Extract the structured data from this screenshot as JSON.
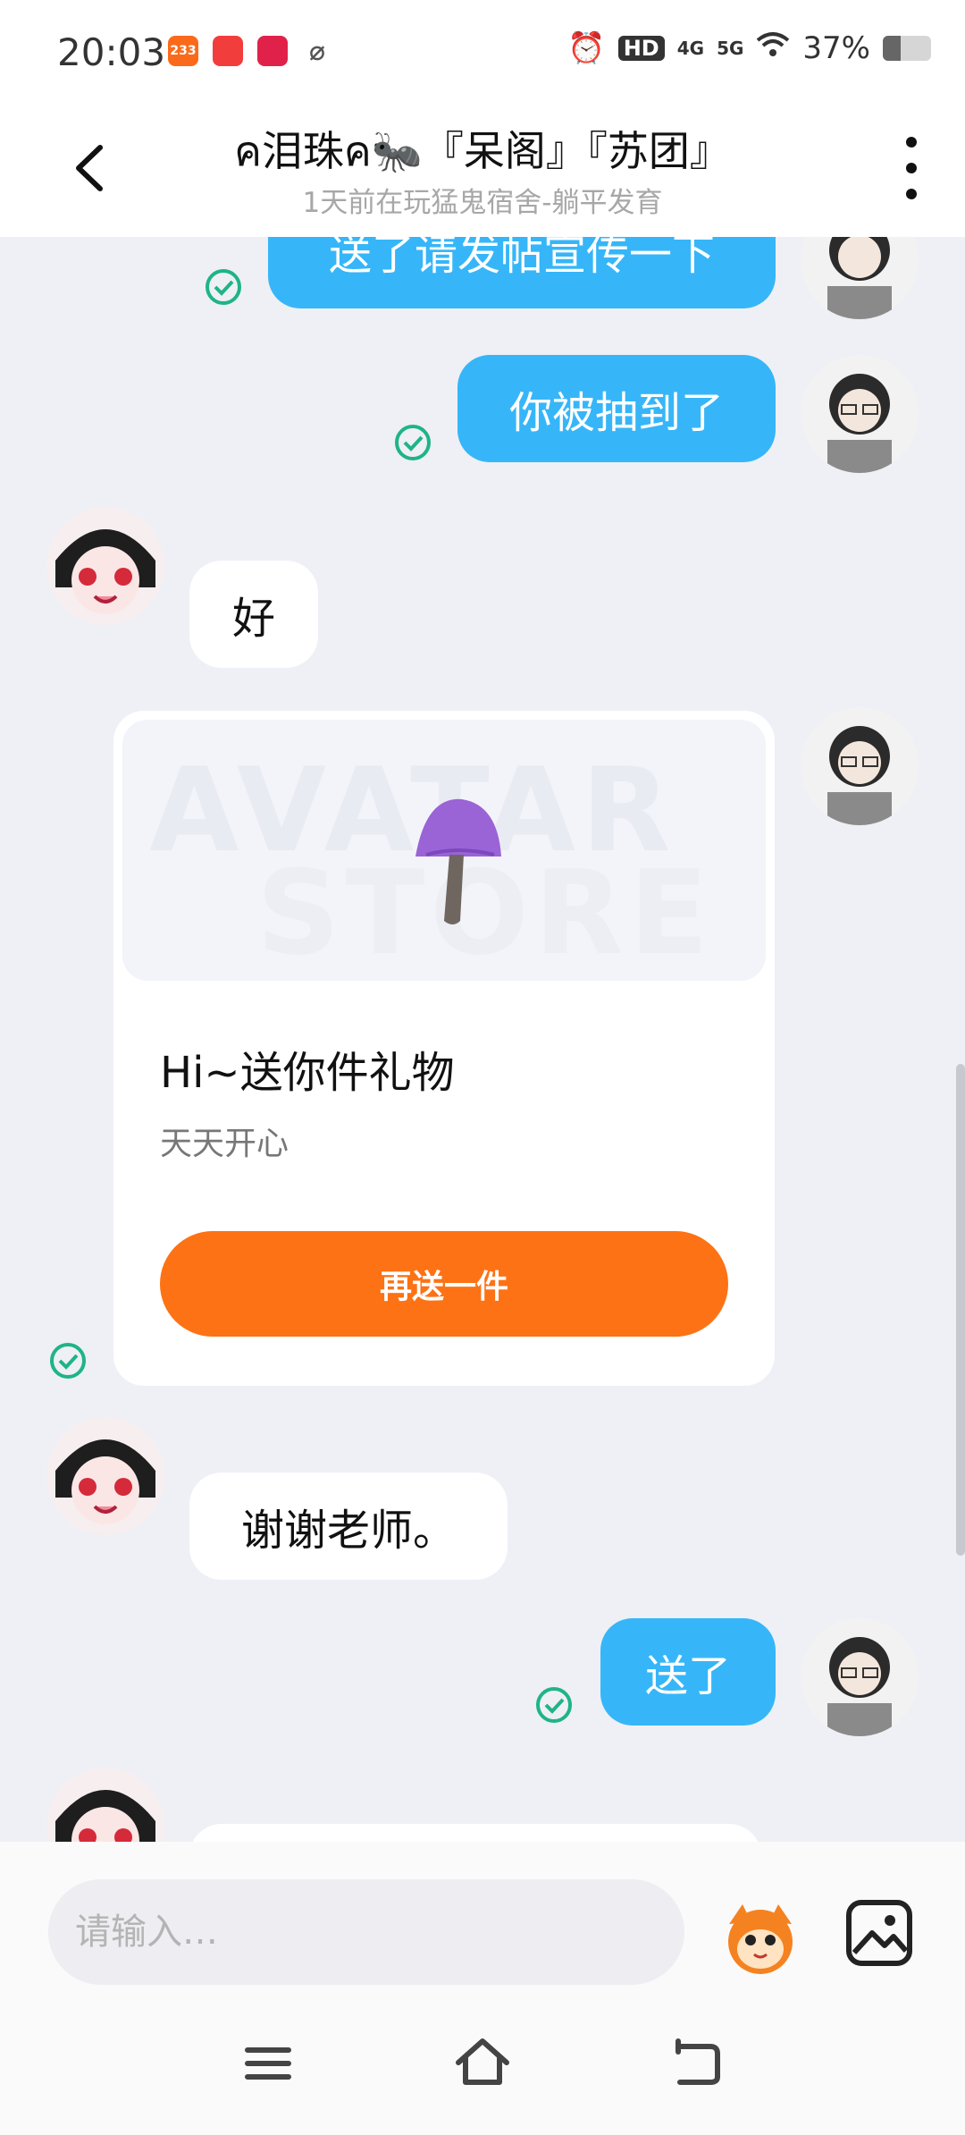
{
  "status_bar": {
    "time": "20:03",
    "app_icons": [
      {
        "name": "233-icon",
        "label": "233",
        "color": "#fb6a1a"
      },
      {
        "name": "music-app-icon",
        "label": "",
        "color": "#f23d3d"
      },
      {
        "name": "shopping-app-icon",
        "label": "",
        "color": "#e0224b"
      },
      {
        "name": "link-app-icon",
        "label": "",
        "color": "#555555"
      }
    ],
    "network_hd": "HD",
    "signal_4g": "4G",
    "signal_5g": "5G",
    "battery": "37%",
    "battery_level": 0.37
  },
  "header": {
    "title": "ค泪珠ค🐜『呆阁』『苏团』",
    "subtitle": "1天前在玩猛鬼宿舍-躺平发育"
  },
  "messages": [
    {
      "side": "out",
      "text": "送了请发帖宣传一下"
    },
    {
      "side": "out",
      "text": "你被抽到了"
    },
    {
      "side": "in",
      "text": "好"
    },
    {
      "side": "out",
      "type": "gift"
    },
    {
      "side": "in",
      "text": "谢谢老师。"
    },
    {
      "side": "out",
      "text": "送了"
    }
  ],
  "gift_card": {
    "watermark_line1": "AVATAR",
    "watermark_line2": "STORE",
    "title": "Hi~送你件礼物",
    "subtitle": "天天开心",
    "button_label": "再送一件"
  },
  "input_bar": {
    "placeholder": "请输入…"
  },
  "colors": {
    "outgoing_bubble": "#36b6f8",
    "incoming_bubble": "#ffffff",
    "gift_button": "#fd7214",
    "read_check": "#1fb487"
  }
}
